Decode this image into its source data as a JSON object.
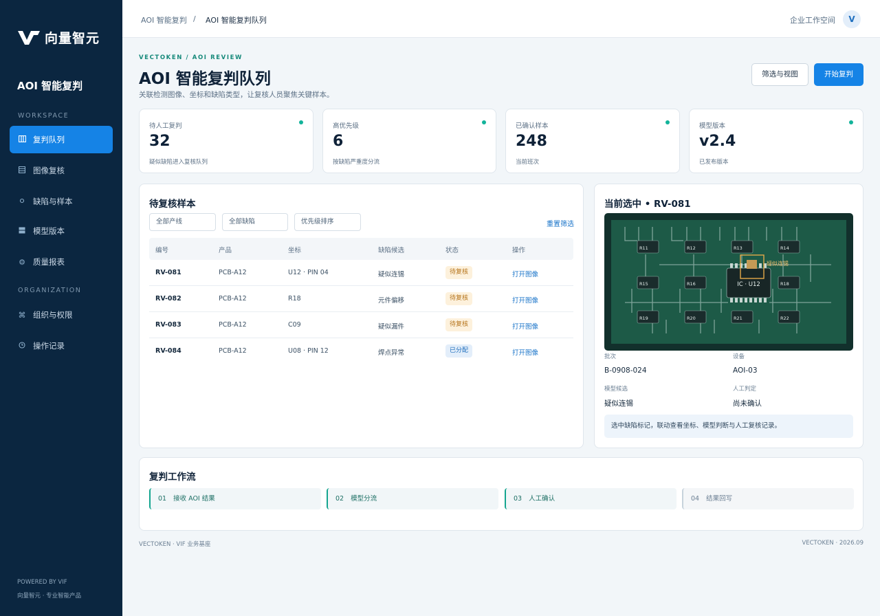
{
  "brand": {
    "name": "向量智元",
    "app_title": "AOI 智能复判"
  },
  "sidebar": {
    "workspace_label": "WORKSPACE",
    "organization_label": "ORGANIZATION",
    "items": [
      {
        "label": "复判队列",
        "icon": "columns-icon"
      },
      {
        "label": "图像复核",
        "icon": "image-list-icon"
      },
      {
        "label": "缺陷与样本",
        "icon": "dot-icon"
      },
      {
        "label": "模型版本",
        "icon": "grid-icon"
      },
      {
        "label": "质量报表",
        "icon": "gear-icon"
      }
    ],
    "org_items": [
      {
        "label": "组织与权限",
        "icon": "command-icon"
      },
      {
        "label": "操作记录",
        "icon": "clock-icon"
      }
    ],
    "footer_line1": "POWERED BY VIF",
    "footer_line2": "向量智元 · 专业智能产品"
  },
  "topbar": {
    "breadcrumb": [
      "AOI 智能复判",
      "AOI 智能复判队列"
    ],
    "separator": "/",
    "workspace": "企业工作空间",
    "avatar": "V"
  },
  "header": {
    "eyebrow": "VECTOKEN / AOI REVIEW",
    "title": "AOI 智能复判队列",
    "subtitle": "关联检测图像、坐标和缺陷类型，让复核人员聚焦关键样本。",
    "filter_button": "筛选与视图",
    "start_button": "开始复判"
  },
  "stats": [
    {
      "label": "待人工复判",
      "value": "32",
      "note": "疑似缺陷进入复核队列"
    },
    {
      "label": "高优先级",
      "value": "6",
      "note": "按缺陷严重度分流"
    },
    {
      "label": "已确认样本",
      "value": "248",
      "note": "当前班次"
    },
    {
      "label": "模型版本",
      "value": "v2.4",
      "note": "已发布版本"
    }
  ],
  "queue": {
    "title": "待复核样本",
    "filters": [
      "全部产线",
      "全部缺陷",
      "优先级排序"
    ],
    "reset": "重置筛选",
    "columns": [
      "编号",
      "产品",
      "坐标",
      "缺陷候选",
      "状态",
      "操作"
    ],
    "rows": [
      {
        "id": "RV-081",
        "product": "PCB-A12",
        "coord": "U12 · PIN 04",
        "defect": "疑似连锡",
        "status": "待复核",
        "status_type": "pending",
        "action": "打开图像"
      },
      {
        "id": "RV-082",
        "product": "PCB-A12",
        "coord": "R18",
        "defect": "元件偏移",
        "status": "待复核",
        "status_type": "pending",
        "action": "打开图像"
      },
      {
        "id": "RV-083",
        "product": "PCB-A12",
        "coord": "C09",
        "defect": "疑似漏件",
        "status": "待复核",
        "status_type": "pending",
        "action": "打开图像"
      },
      {
        "id": "RV-084",
        "product": "PCB-A12",
        "coord": "U08 · PIN 12",
        "defect": "焊点异常",
        "status": "已分配",
        "status_type": "assigned",
        "action": "打开图像"
      }
    ]
  },
  "detail": {
    "title": "当前选中 • RV-081",
    "pcb": {
      "components": [
        "R11",
        "R12",
        "R13",
        "R14",
        "R15",
        "R16",
        "R18",
        "R19",
        "R20",
        "R21",
        "R22"
      ],
      "chip": "IC · U12",
      "marker": "疑似连锡"
    },
    "fields": [
      {
        "label": "批次",
        "value": "B-0908-024"
      },
      {
        "label": "设备",
        "value": "AOI-03"
      },
      {
        "label": "模型候选",
        "value": "疑似连锡"
      },
      {
        "label": "人工判定",
        "value": "尚未确认"
      }
    ],
    "tip": "选中缺陷标记，联动查看坐标、模型判断与人工复核记录。"
  },
  "workflow": {
    "title": "复判工作流",
    "steps": [
      {
        "num": "01",
        "label": "接收 AOI 结果",
        "active": true
      },
      {
        "num": "02",
        "label": "模型分流",
        "active": true
      },
      {
        "num": "03",
        "label": "人工确认",
        "active": true
      },
      {
        "num": "04",
        "label": "结果回写",
        "active": false
      }
    ]
  },
  "footer": {
    "left": "VECTOKEN · VIF 业务基座",
    "right": "VECTOKEN · 2026.09"
  },
  "colors": {
    "sidebar": "#0b2640",
    "accent": "#1583e6",
    "success": "#12b39a",
    "pcb_board": "#1d5a47"
  }
}
